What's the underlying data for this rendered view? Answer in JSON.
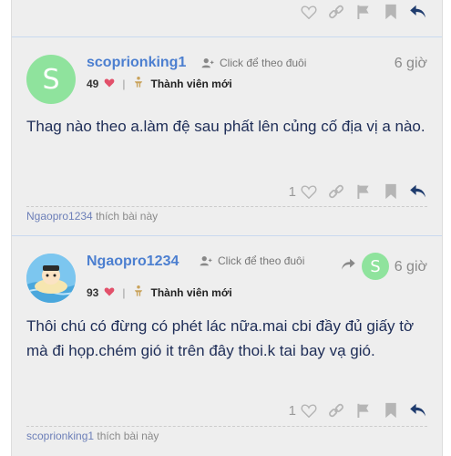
{
  "prev_post": {},
  "posts": [
    {
      "avatar_letter": "S",
      "username": "scoprionking1",
      "follow_label": "Click để theo đuôi",
      "time": "6 giờ",
      "reputation": "49",
      "rank": "Thành viên mới",
      "content": "Thag nào theo a.làm đệ sau phất lên củng cố địa vị a nào.",
      "like_count": "1",
      "liked_by": "Ngaopro1234",
      "liked_suffix": " thích bài này"
    },
    {
      "username": "Ngaopro1234",
      "follow_label": "Click để theo đuôi",
      "reply_to_letter": "S",
      "time": "6 giờ",
      "reputation": "93",
      "rank": "Thành viên mới",
      "content_line1": "Thôi chú có đừng có phét lác nữa.mai cbi đầy đủ giấy tờ",
      "content_line2": "mà đi họp.chém gió it trên đây thoi.k tai bay vạ gió.",
      "like_count": "1",
      "liked_by": "scoprionking1",
      "liked_suffix": " thích bài này"
    }
  ],
  "colors": {
    "accent": "#4c7fd0",
    "avatar": "#8fe39d",
    "heart": "#e2506a",
    "text": "#1e2d57"
  }
}
